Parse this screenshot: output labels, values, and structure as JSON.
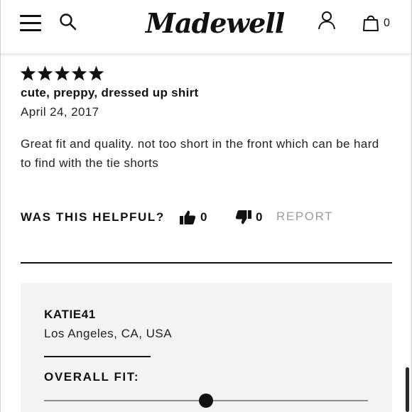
{
  "header": {
    "logo_text": "Madewell",
    "bag_count": "0"
  },
  "review": {
    "rating": 5,
    "rating_max": 5,
    "title": "cute, preppy, dressed up shirt",
    "date": "April 24, 2017",
    "body": "Great fit and quality. not too short in the front which can be hard to find with the tie shorts"
  },
  "helpful": {
    "label": "WAS THIS HELPFUL?",
    "up_count": "0",
    "down_count": "0",
    "report_label": "REPORT"
  },
  "reviewer": {
    "name": "KATIE41",
    "location": "Los Angeles, CA, USA",
    "fit_label": "OVERALL FIT:",
    "overall_fit_position": 0.5
  },
  "icons": {
    "menu": "hamburger-menu-icon",
    "search": "search-icon",
    "account": "account-icon",
    "bag": "shopping-bag-icon",
    "star": "star-icon",
    "thumbs_up": "thumbs-up-icon",
    "thumbs_down": "thumbs-down-icon"
  },
  "colors": {
    "text": "#111111",
    "muted": "#9c9c9c",
    "card_background": "#f3f3f3"
  }
}
